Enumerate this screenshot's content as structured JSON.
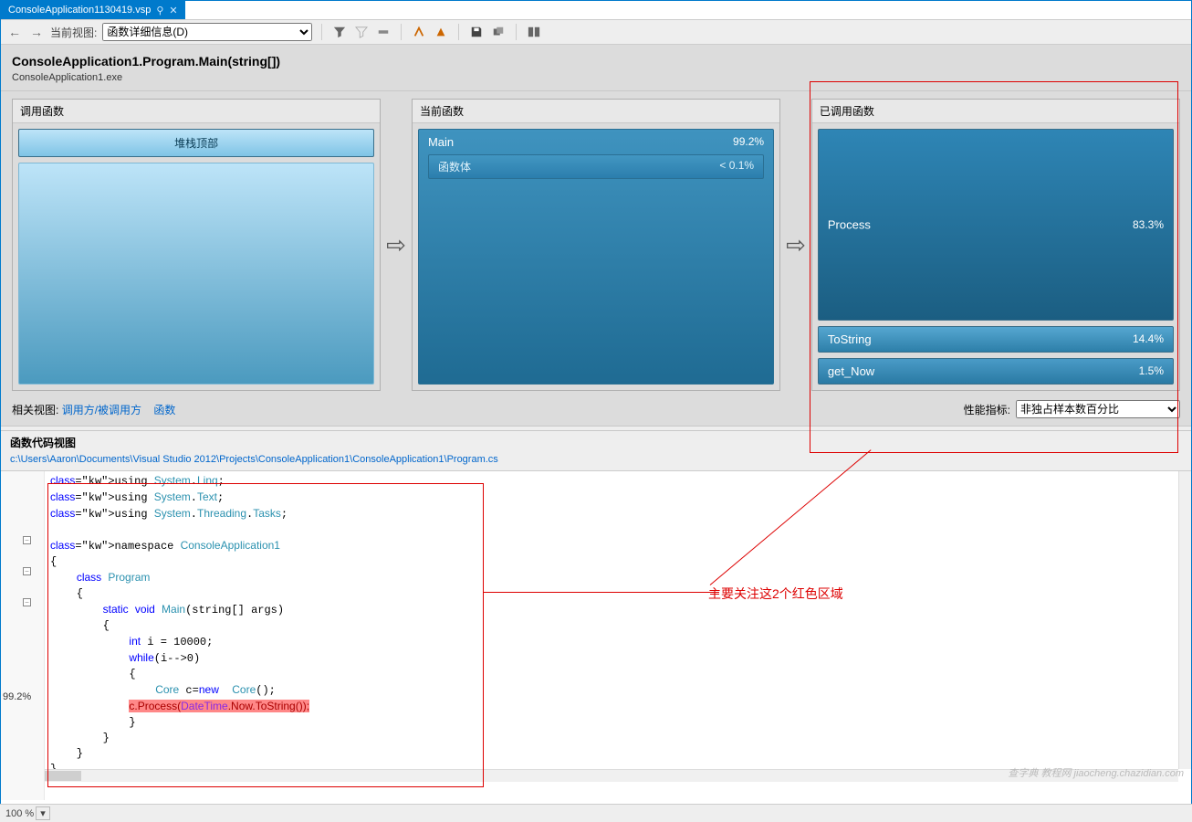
{
  "tab": {
    "title": "ConsoleApplication1130419.vsp",
    "pin": "⚲",
    "close": "✕"
  },
  "toolbar": {
    "back": "←",
    "fwd": "→",
    "view_label": "当前视图:",
    "view_value": "函数详细信息(D)"
  },
  "header": {
    "title": "ConsoleApplication1.Program.Main(string[])",
    "subtitle": "ConsoleApplication1.exe"
  },
  "panels": {
    "calling": {
      "title": "调用函数",
      "stack_top": "堆栈顶部"
    },
    "current": {
      "title": "当前函数",
      "main": {
        "name": "Main",
        "pct": "99.2%"
      },
      "body": {
        "name": "函数体",
        "pct": "< 0.1%"
      }
    },
    "called": {
      "title": "已调用函数",
      "items": [
        {
          "name": "Process",
          "pct": "83.3%",
          "cls": "big"
        },
        {
          "name": "ToString",
          "pct": "14.4%",
          "cls": "med"
        },
        {
          "name": "get_Now",
          "pct": "1.5%",
          "cls": "small"
        }
      ]
    }
  },
  "related": {
    "label": "相关视图:",
    "link1": "调用方/被调用方",
    "link2": "函数",
    "metric_label": "性能指标:",
    "metric_value": "非独占样本数百分比"
  },
  "code": {
    "header": "函数代码视图",
    "path": "c:\\Users\\Aaron\\Documents\\Visual Studio 2012\\Projects\\ConsoleApplication1\\ConsoleApplication1\\Program.cs",
    "margin_pct": "99.2%",
    "lines": [
      "using System.Linq;",
      "using System.Text;",
      "using System.Threading.Tasks;",
      "",
      "namespace ConsoleApplication1",
      "{",
      "    class Program",
      "    {",
      "        static void Main(string[] args)",
      "        {",
      "            int i = 10000;",
      "            while(i-->0)",
      "            {",
      "                Core c=new  Core();",
      "                c.Process(DateTime.Now.ToString());",
      "            }",
      "        }",
      "    }",
      "}"
    ],
    "highlight_text": "c.Process(DateTime.Now.ToString());"
  },
  "annotation": "主要关注这2个红色区域",
  "status": {
    "zoom": "100 %"
  },
  "watermark": "查字典 教程网\njiaocheng.chazidian.com"
}
